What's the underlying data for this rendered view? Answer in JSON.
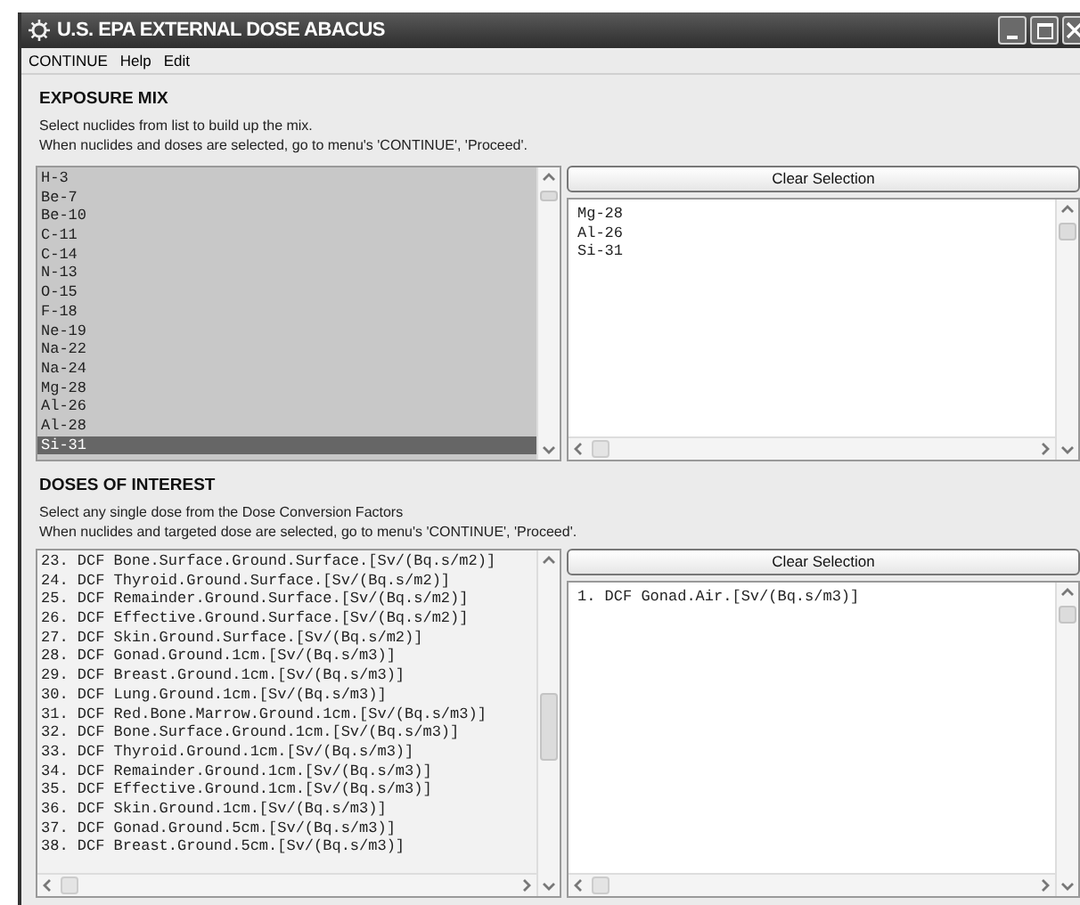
{
  "window": {
    "title": "U.S. EPA EXTERNAL DOSE ABACUS"
  },
  "menu": [
    "CONTINUE",
    "Help",
    "Edit"
  ],
  "exposure_mix": {
    "heading": "EXPOSURE MIX",
    "instructions": [
      "Select nuclides from list to build up the mix.",
      "When nuclides and doses are selected, go to menu's 'CONTINUE', 'Proceed'."
    ],
    "nuclides": [
      {
        "label": "H-3",
        "selected": false
      },
      {
        "label": "Be-7",
        "selected": false
      },
      {
        "label": "Be-10",
        "selected": false
      },
      {
        "label": "C-11",
        "selected": false
      },
      {
        "label": "C-14",
        "selected": false
      },
      {
        "label": "N-13",
        "selected": false
      },
      {
        "label": "O-15",
        "selected": false
      },
      {
        "label": "F-18",
        "selected": false
      },
      {
        "label": "Ne-19",
        "selected": false
      },
      {
        "label": "Na-22",
        "selected": false
      },
      {
        "label": "Na-24",
        "selected": false
      },
      {
        "label": "Mg-28",
        "selected": false
      },
      {
        "label": "Al-26",
        "selected": false
      },
      {
        "label": "Al-28",
        "selected": false
      },
      {
        "label": "Si-31",
        "selected": true
      }
    ],
    "clear_button": "Clear Selection",
    "selected_items": [
      "Mg-28",
      "Al-26",
      "Si-31"
    ]
  },
  "doses_of_interest": {
    "heading": "DOSES OF INTEREST",
    "instructions": [
      "Select any single dose from the Dose Conversion Factors",
      "When nuclides and targeted dose are selected, go to menu's 'CONTINUE', 'Proceed'."
    ],
    "doses": [
      {
        "label": "23. DCF Bone.Surface.Ground.Surface.[Sv/(Bq.s/m2)]",
        "selected": false
      },
      {
        "label": "24. DCF Thyroid.Ground.Surface.[Sv/(Bq.s/m2)]",
        "selected": false
      },
      {
        "label": "25. DCF Remainder.Ground.Surface.[Sv/(Bq.s/m2)]",
        "selected": false
      },
      {
        "label": "26. DCF Effective.Ground.Surface.[Sv/(Bq.s/m2)]",
        "selected": false
      },
      {
        "label": "27. DCF Skin.Ground.Surface.[Sv/(Bq.s/m2)]",
        "selected": false
      },
      {
        "label": "28. DCF Gonad.Ground.1cm.[Sv/(Bq.s/m3)]",
        "selected": false
      },
      {
        "label": "29. DCF Breast.Ground.1cm.[Sv/(Bq.s/m3)]",
        "selected": false
      },
      {
        "label": "30. DCF Lung.Ground.1cm.[Sv/(Bq.s/m3)]",
        "selected": false
      },
      {
        "label": "31. DCF Red.Bone.Marrow.Ground.1cm.[Sv/(Bq.s/m3)]",
        "selected": false
      },
      {
        "label": "32. DCF Bone.Surface.Ground.1cm.[Sv/(Bq.s/m3)]",
        "selected": false
      },
      {
        "label": "33. DCF Thyroid.Ground.1cm.[Sv/(Bq.s/m3)]",
        "selected": false
      },
      {
        "label": "34. DCF Remainder.Ground.1cm.[Sv/(Bq.s/m3)]",
        "selected": false
      },
      {
        "label": "35. DCF Effective.Ground.1cm.[Sv/(Bq.s/m3)]",
        "selected": false
      },
      {
        "label": "36. DCF Skin.Ground.1cm.[Sv/(Bq.s/m3)]",
        "selected": false
      },
      {
        "label": "37. DCF Gonad.Ground.5cm.[Sv/(Bq.s/m3)]",
        "selected": false
      },
      {
        "label": "38. DCF Breast.Ground.5cm.[Sv/(Bq.s/m3)]",
        "selected": false
      }
    ],
    "clear_button": "Clear Selection",
    "selected_items": [
      "1. DCF Gonad.Air.[Sv/(Bq.s/m3)]"
    ]
  }
}
